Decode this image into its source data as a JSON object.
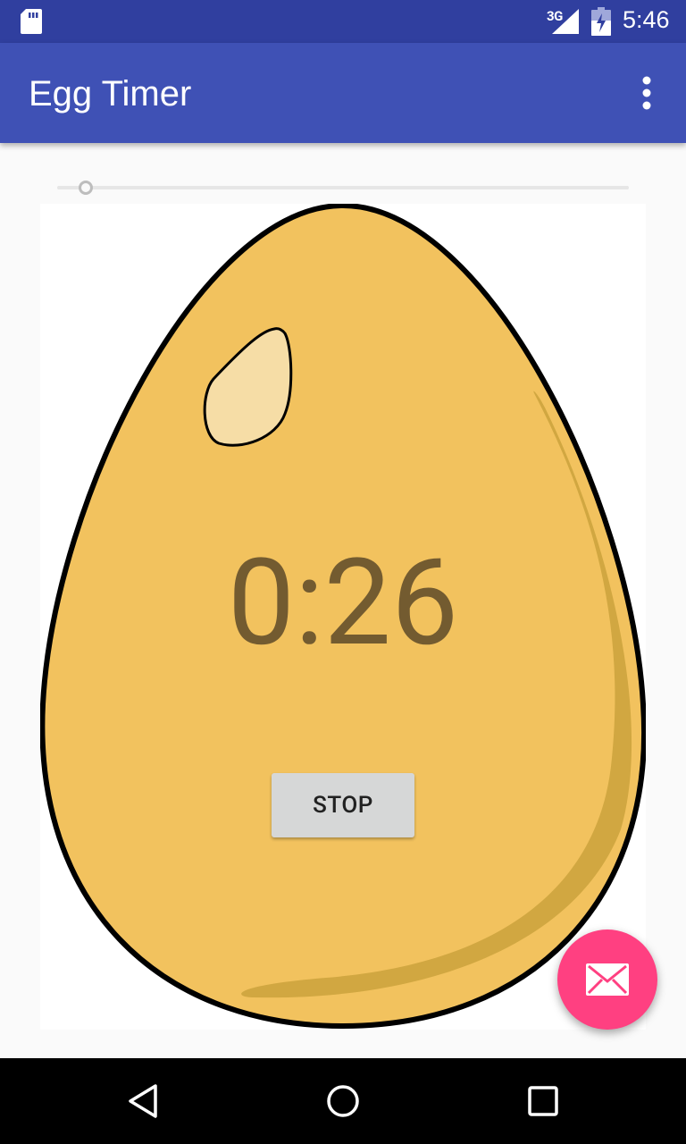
{
  "status_bar": {
    "network_type": "3G",
    "time": "5:46"
  },
  "app_bar": {
    "title": "Egg Timer"
  },
  "timer": {
    "display": "0:26",
    "stop_label": "STOP",
    "seek_level": 0.05
  },
  "colors": {
    "status_bar": "#303f9f",
    "app_bar": "#3f51b5",
    "fab": "#ff4081",
    "egg_fill": "#f2c25e",
    "timer_text": "#735b30"
  },
  "icons": {
    "fab": "mail-icon",
    "overflow": "more-vert-icon",
    "back": "back-icon",
    "home": "home-icon",
    "recents": "recents-icon"
  }
}
